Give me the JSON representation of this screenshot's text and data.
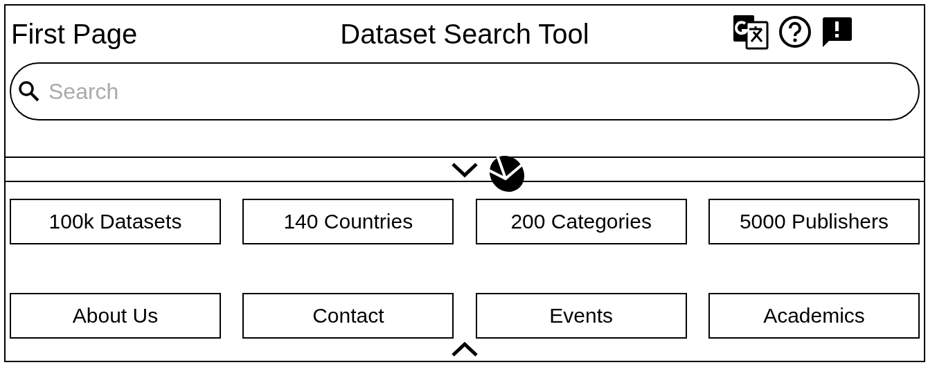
{
  "header": {
    "page_label": "First Page",
    "title": "Dataset Search Tool"
  },
  "search": {
    "placeholder": "Search"
  },
  "stats": [
    "100k Datasets",
    "140 Countries",
    "200 Categories",
    "5000 Publishers"
  ],
  "nav": [
    "About Us",
    "Contact",
    "Events",
    "Academics"
  ]
}
